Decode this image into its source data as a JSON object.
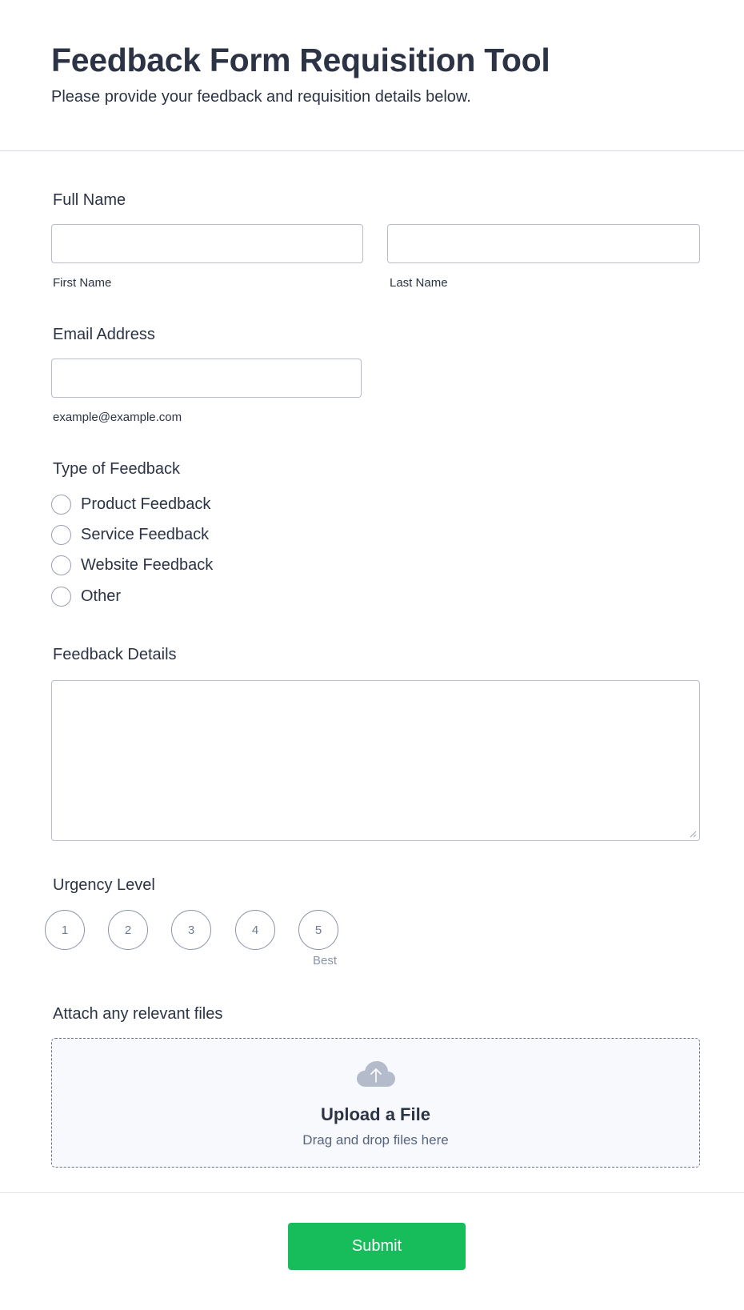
{
  "header": {
    "title": "Feedback Form Requisition Tool",
    "subtitle": "Please provide your feedback and requisition details below."
  },
  "full_name": {
    "label": "Full Name",
    "first": {
      "value": "",
      "sublabel": "First Name"
    },
    "last": {
      "value": "",
      "sublabel": "Last Name"
    }
  },
  "email": {
    "label": "Email Address",
    "value": "",
    "sublabel": "example@example.com"
  },
  "feedback_type": {
    "label": "Type of Feedback",
    "options": [
      "Product Feedback",
      "Service Feedback",
      "Website Feedback",
      "Other"
    ],
    "selected": null
  },
  "feedback_details": {
    "label": "Feedback Details",
    "value": ""
  },
  "urgency": {
    "label": "Urgency Level",
    "options": [
      "1",
      "2",
      "3",
      "4",
      "5"
    ],
    "hint": "Best",
    "selected": null
  },
  "attachments": {
    "label": "Attach any relevant files",
    "title": "Upload a File",
    "subtitle": "Drag and drop files here",
    "icon": "cloud-upload-icon"
  },
  "submit": {
    "label": "Submit"
  },
  "colors": {
    "text": "#2c3345",
    "border": "#b8bdc9",
    "submit": "#18bd5b",
    "upload_bg": "#f8f9fc",
    "rating_border": "#8a93a8"
  }
}
